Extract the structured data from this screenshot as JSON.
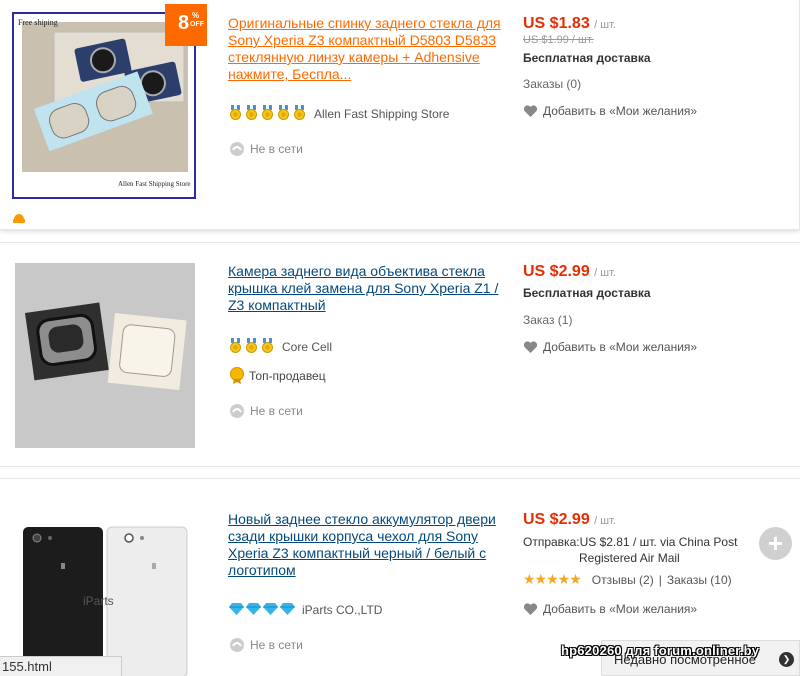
{
  "products": [
    {
      "badge_number": "8",
      "badge_percent": "%",
      "badge_off": "OFF",
      "image_caption_top": "Free shiping",
      "image_caption_bottom": "Allen Fast Shipping Store",
      "title": "Оригинальные спинку заднего стекла для Sony Xperia Z3 компактный D5803 D5833 стеклянную линзу камеры + Adhensive нажмите, Беспла...",
      "store_name": "Allen Fast Shipping Store",
      "store_medals": 5,
      "status": "Не в сети",
      "price": "US $1.83",
      "price_unit": "/ шт.",
      "old_price": "US $1.99 / шт.",
      "shipping": "Бесплатная доставка",
      "orders": "Заказы (0)",
      "wishlist": "Добавить в «Мои желания»"
    },
    {
      "title": "Камера заднего вида объектива стекла крышка клей замена для Sony Xperia Z1 / Z3 компактный",
      "store_name": "Core Cell",
      "store_medals": 3,
      "top_seller": "Топ-продавец",
      "status": "Не в сети",
      "price": "US $2.99",
      "price_unit": "/ шт.",
      "shipping": "Бесплатная доставка",
      "orders": "Заказ (1)",
      "wishlist": "Добавить в «Мои желания»"
    },
    {
      "title": "Новый заднее стекло аккумулятор двери сзади крышки корпуса чехол для Sony Xperia Z3 компактный черный / белый с логотипом",
      "image_caption": "iParts",
      "store_name": "iParts CO.,LTD",
      "store_diamonds": 4,
      "status": "Не в сети",
      "price": "US $2.99",
      "price_unit": "/ шт.",
      "shipping_line1": "Отправка:US $2.81 / шт. via China Post",
      "shipping_line2": "Registered Air Mail",
      "stars": "★★★★★",
      "reviews": "Отзывы (2)",
      "separator": "|",
      "orders": "Заказы (10)",
      "wishlist": "Добавить в «Мои желания»"
    }
  ],
  "statusbar": {
    "url": "155.html"
  },
  "recently_viewed": {
    "label": "Недавно посмотренное",
    "chevron": "❯"
  },
  "watermark": "hp620260 для forum.onliner.by",
  "plus_symbol": "+",
  "colors": {
    "accent": "#ff6a00",
    "price": "#e62e04",
    "link": "#05497c",
    "star": "#f5a623"
  }
}
